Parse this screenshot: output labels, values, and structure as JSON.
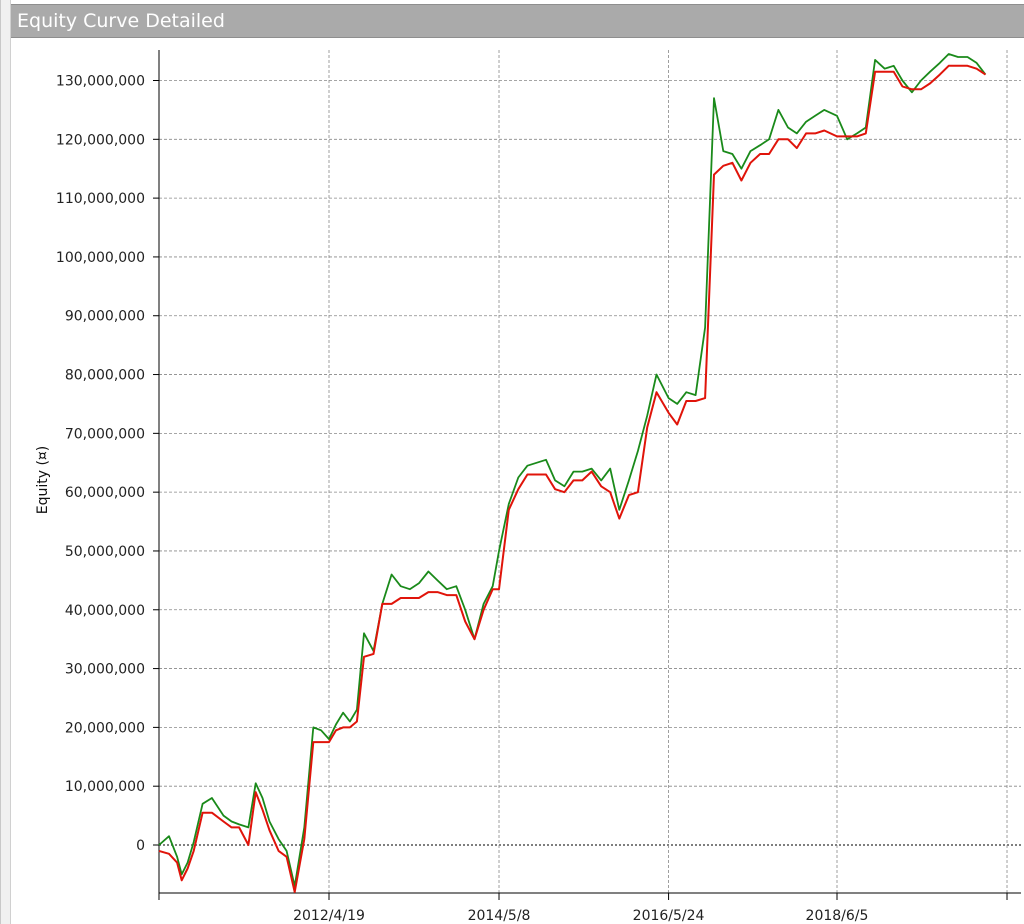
{
  "window": {
    "title": "Equity Curve Detailed"
  },
  "chart_data": {
    "type": "line",
    "title": "Equity Curve Detailed",
    "xlabel": "",
    "ylabel": "Equity (¤)",
    "ylim": [
      -8000000,
      135000000
    ],
    "x_ticks": [
      "2012/4/19",
      "2014/5/8",
      "2016/5/24",
      "2018/6/5"
    ],
    "y_ticks": [
      "0",
      "10,000,000",
      "20,000,000",
      "30,000,000",
      "40,000,000",
      "50,000,000",
      "60,000,000",
      "70,000,000",
      "80,000,000",
      "90,000,000",
      "100,000,000",
      "110,000,000",
      "120,000,000",
      "130,000,000"
    ],
    "y_tick_values": [
      0,
      10000000,
      20000000,
      30000000,
      40000000,
      50000000,
      60000000,
      70000000,
      80000000,
      90000000,
      100000000,
      110000000,
      120000000,
      130000000
    ],
    "grid": true,
    "colors": {
      "closed_equity": "#e0140a",
      "open_peak": "#1a8a1a",
      "grid": "#888888"
    },
    "series": [
      {
        "role": "open_peak",
        "x": [
          "2010/4/1",
          "2010/5/15",
          "2010/6/20",
          "2010/7/10",
          "2010/8/5",
          "2010/9/1",
          "2010/10/10",
          "2010/11/20",
          "2011/1/10",
          "2011/2/15",
          "2011/3/20",
          "2011/4/30",
          "2011/6/1",
          "2011/7/1",
          "2011/8/1",
          "2011/9/10",
          "2011/10/15",
          "2011/11/20",
          "2012/1/1",
          "2012/2/10",
          "2012/3/15",
          "2012/4/19",
          "2012/5/20",
          "2012/6/20",
          "2012/7/20",
          "2012/8/20",
          "2012/9/20",
          "2012/11/1",
          "2012/12/10",
          "2013/1/20",
          "2013/3/1",
          "2013/4/10",
          "2013/5/20",
          "2013/7/1",
          "2013/8/10",
          "2013/9/20",
          "2013/11/1",
          "2013/12/10",
          "2014/1/20",
          "2014/3/1",
          "2014/4/10",
          "2014/5/8",
          "2014/6/20",
          "2014/8/1",
          "2014/9/10",
          "2014/10/20",
          "2014/12/1",
          "2015/1/10",
          "2015/2/20",
          "2015/4/1",
          "2015/5/10",
          "2015/6/20",
          "2015/8/1",
          "2015/9/10",
          "2015/10/20",
          "2015/12/1",
          "2016/1/10",
          "2016/2/20",
          "2016/4/1",
          "2016/5/24",
          "2016/7/1",
          "2016/8/10",
          "2016/9/20",
          "2016/11/1",
          "2016/12/10",
          "2017/1/20",
          "2017/3/1",
          "2017/4/10",
          "2017/5/20",
          "2017/7/1",
          "2017/8/10",
          "2017/9/20",
          "2017/11/1",
          "2017/12/10",
          "2018/1/20",
          "2018/3/1",
          "2018/4/10",
          "2018/6/5",
          "2018/7/20",
          "2018/9/1",
          "2018/10/10",
          "2018/11/20",
          "2019/1/1",
          "2019/2/10",
          "2019/3/20",
          "2019/5/1",
          "2019/6/10",
          "2019/7/20",
          "2019/9/1",
          "2019/10/10",
          "2019/11/20",
          "2020/1/1",
          "2020/2/10",
          "2020/3/20"
        ],
        "y": [
          0,
          1500000,
          -2000000,
          -5000000,
          -3000000,
          500000,
          7000000,
          8000000,
          5000000,
          4000000,
          3500000,
          3000000,
          10500000,
          8000000,
          4000000,
          1000000,
          -1000000,
          -7000000,
          3000000,
          20000000,
          19500000,
          18000000,
          20500000,
          22500000,
          21000000,
          23000000,
          36000000,
          33000000,
          41000000,
          46000000,
          44000000,
          43500000,
          44500000,
          46500000,
          45000000,
          43500000,
          44000000,
          40000000,
          35000000,
          41000000,
          44000000,
          50000000,
          58000000,
          62500000,
          64500000,
          65000000,
          65500000,
          62000000,
          61000000,
          63500000,
          63500000,
          64000000,
          62000000,
          64000000,
          57000000,
          62000000,
          67000000,
          73000000,
          80000000,
          76000000,
          75000000,
          77000000,
          76500000,
          88000000,
          127000000,
          118000000,
          117500000,
          115000000,
          118000000,
          119000000,
          120000000,
          125000000,
          122000000,
          121000000,
          123000000,
          124000000,
          125000000,
          124000000,
          120000000,
          121000000,
          122000000,
          133500000,
          132000000,
          132500000,
          130000000,
          128000000,
          130000000,
          131500000,
          133000000,
          134500000,
          134000000,
          134000000,
          133000000,
          131000000
        ]
      },
      {
        "role": "closed_equity",
        "x": [
          "2010/4/1",
          "2010/5/15",
          "2010/6/20",
          "2010/7/10",
          "2010/8/5",
          "2010/9/1",
          "2010/10/10",
          "2010/11/20",
          "2011/1/10",
          "2011/2/15",
          "2011/3/20",
          "2011/4/30",
          "2011/6/1",
          "2011/7/1",
          "2011/8/1",
          "2011/9/10",
          "2011/10/15",
          "2011/11/20",
          "2012/1/1",
          "2012/2/10",
          "2012/3/15",
          "2012/4/19",
          "2012/5/20",
          "2012/6/20",
          "2012/7/20",
          "2012/8/20",
          "2012/9/20",
          "2012/11/1",
          "2012/12/10",
          "2013/1/20",
          "2013/3/1",
          "2013/4/10",
          "2013/5/20",
          "2013/7/1",
          "2013/8/10",
          "2013/9/20",
          "2013/11/1",
          "2013/12/10",
          "2014/1/20",
          "2014/3/1",
          "2014/4/10",
          "2014/5/8",
          "2014/6/20",
          "2014/8/1",
          "2014/9/10",
          "2014/10/20",
          "2014/12/1",
          "2015/1/10",
          "2015/2/20",
          "2015/4/1",
          "2015/5/10",
          "2015/6/20",
          "2015/8/1",
          "2015/9/10",
          "2015/10/20",
          "2015/12/1",
          "2016/1/10",
          "2016/2/20",
          "2016/4/1",
          "2016/5/24",
          "2016/7/1",
          "2016/8/10",
          "2016/9/20",
          "2016/11/1",
          "2016/12/10",
          "2017/1/20",
          "2017/3/1",
          "2017/4/10",
          "2017/5/20",
          "2017/7/1",
          "2017/8/10",
          "2017/9/20",
          "2017/11/1",
          "2017/12/10",
          "2018/1/20",
          "2018/3/1",
          "2018/4/10",
          "2018/6/5",
          "2018/7/20",
          "2018/9/1",
          "2018/10/10",
          "2018/11/20",
          "2019/1/1",
          "2019/2/10",
          "2019/3/20",
          "2019/5/1",
          "2019/6/10",
          "2019/7/20",
          "2019/9/1",
          "2019/10/10",
          "2019/11/20",
          "2020/1/1",
          "2020/2/10",
          "2020/3/20"
        ],
        "y": [
          -1000000,
          -1500000,
          -3000000,
          -6000000,
          -4000000,
          -1000000,
          5500000,
          5500000,
          4000000,
          3000000,
          3000000,
          0,
          9000000,
          6000000,
          2500000,
          -1000000,
          -2000000,
          -8000000,
          1000000,
          17500000,
          17500000,
          17500000,
          19500000,
          20000000,
          20000000,
          21000000,
          32000000,
          32500000,
          41000000,
          41000000,
          42000000,
          42000000,
          42000000,
          43000000,
          43000000,
          42500000,
          42500000,
          38000000,
          35000000,
          40000000,
          43500000,
          43500000,
          57000000,
          60500000,
          63000000,
          63000000,
          63000000,
          60500000,
          60000000,
          62000000,
          62000000,
          63500000,
          61000000,
          60000000,
          55500000,
          59500000,
          60000000,
          71000000,
          77000000,
          73500000,
          71500000,
          75500000,
          75500000,
          76000000,
          114000000,
          115500000,
          116000000,
          113000000,
          116000000,
          117500000,
          117500000,
          120000000,
          120000000,
          118500000,
          121000000,
          121000000,
          121500000,
          120500000,
          120500000,
          120500000,
          121000000,
          131500000,
          131500000,
          131500000,
          129000000,
          128500000,
          128500000,
          129500000,
          131000000,
          132500000,
          132500000,
          132500000,
          132000000,
          131000000
        ]
      }
    ]
  }
}
